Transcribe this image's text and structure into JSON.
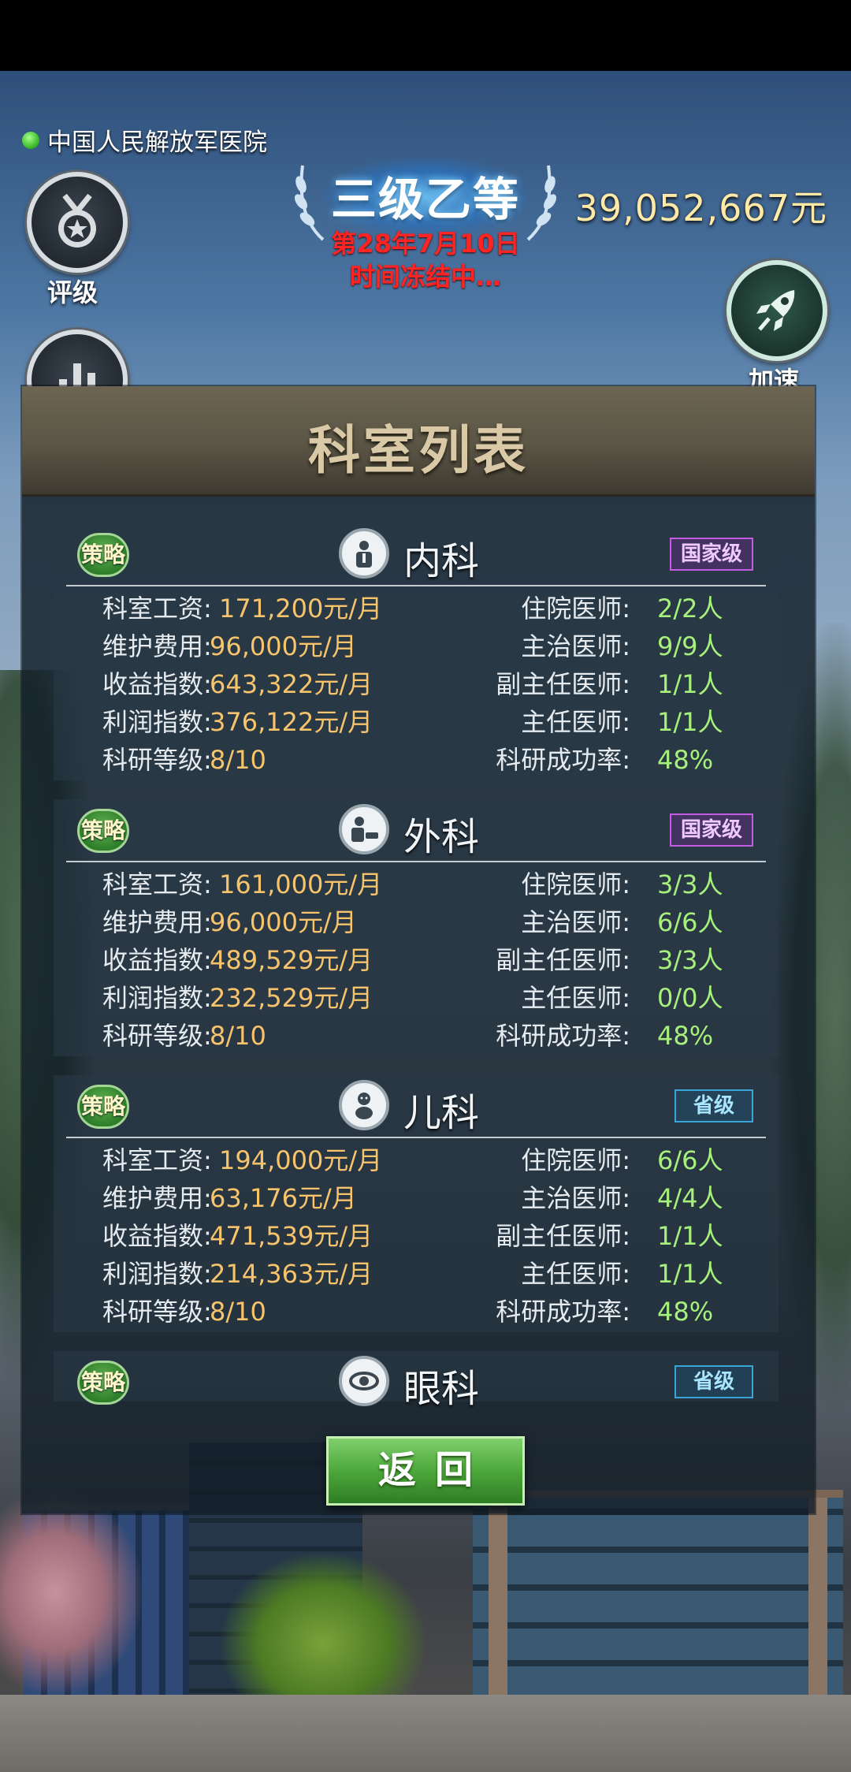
{
  "header": {
    "hospital_name": "中国人民解放军医院",
    "rank": "三级乙等",
    "date": "第28年7月10日",
    "status": "时间冻结中…",
    "money": "39,052,667元"
  },
  "buttons": {
    "rating_label": "评级",
    "speed_label": "加速"
  },
  "panel": {
    "title": "科室列表",
    "back_label": "返回"
  },
  "labels": {
    "strategy": "策略",
    "salary": "科室工资:",
    "maintenance": "维护费用:",
    "revenue": "收益指数:",
    "profit": "利润指数:",
    "research_level": "科研等级:",
    "resident": "住院医师:",
    "attending": "主治医师:",
    "associate_chief": "副主任医师:",
    "chief": "主任医师:",
    "research_rate": "科研成功率:"
  },
  "departments": [
    {
      "name": "内科",
      "level": "国家级",
      "icon": "internal-medicine-icon",
      "salary": "171,200元/月",
      "maintenance": "96,000元/月",
      "revenue": "643,322元/月",
      "profit": "376,122元/月",
      "research_level": "8/10",
      "resident": "2/2人",
      "attending": "9/9人",
      "associate_chief": "1/1人",
      "chief": "1/1人",
      "research_rate": "48%"
    },
    {
      "name": "外科",
      "level": "国家级",
      "icon": "surgery-icon",
      "salary": "161,000元/月",
      "maintenance": "96,000元/月",
      "revenue": "489,529元/月",
      "profit": "232,529元/月",
      "research_level": "8/10",
      "resident": "3/3人",
      "attending": "6/6人",
      "associate_chief": "3/3人",
      "chief": "0/0人",
      "research_rate": "48%"
    },
    {
      "name": "儿科",
      "level": "省级",
      "icon": "pediatrics-icon",
      "salary": "194,000元/月",
      "maintenance": "63,176元/月",
      "revenue": "471,539元/月",
      "profit": "214,363元/月",
      "research_level": "8/10",
      "resident": "6/6人",
      "attending": "4/4人",
      "associate_chief": "1/1人",
      "chief": "1/1人",
      "research_rate": "48%"
    },
    {
      "name": "眼科",
      "level": "省级",
      "icon": "eye-icon"
    }
  ],
  "colors": {
    "value_orange": "#f7c46b",
    "value_green": "#a7f07c",
    "date_red": "#ff2424",
    "money_yellow": "#ffe9a6"
  }
}
